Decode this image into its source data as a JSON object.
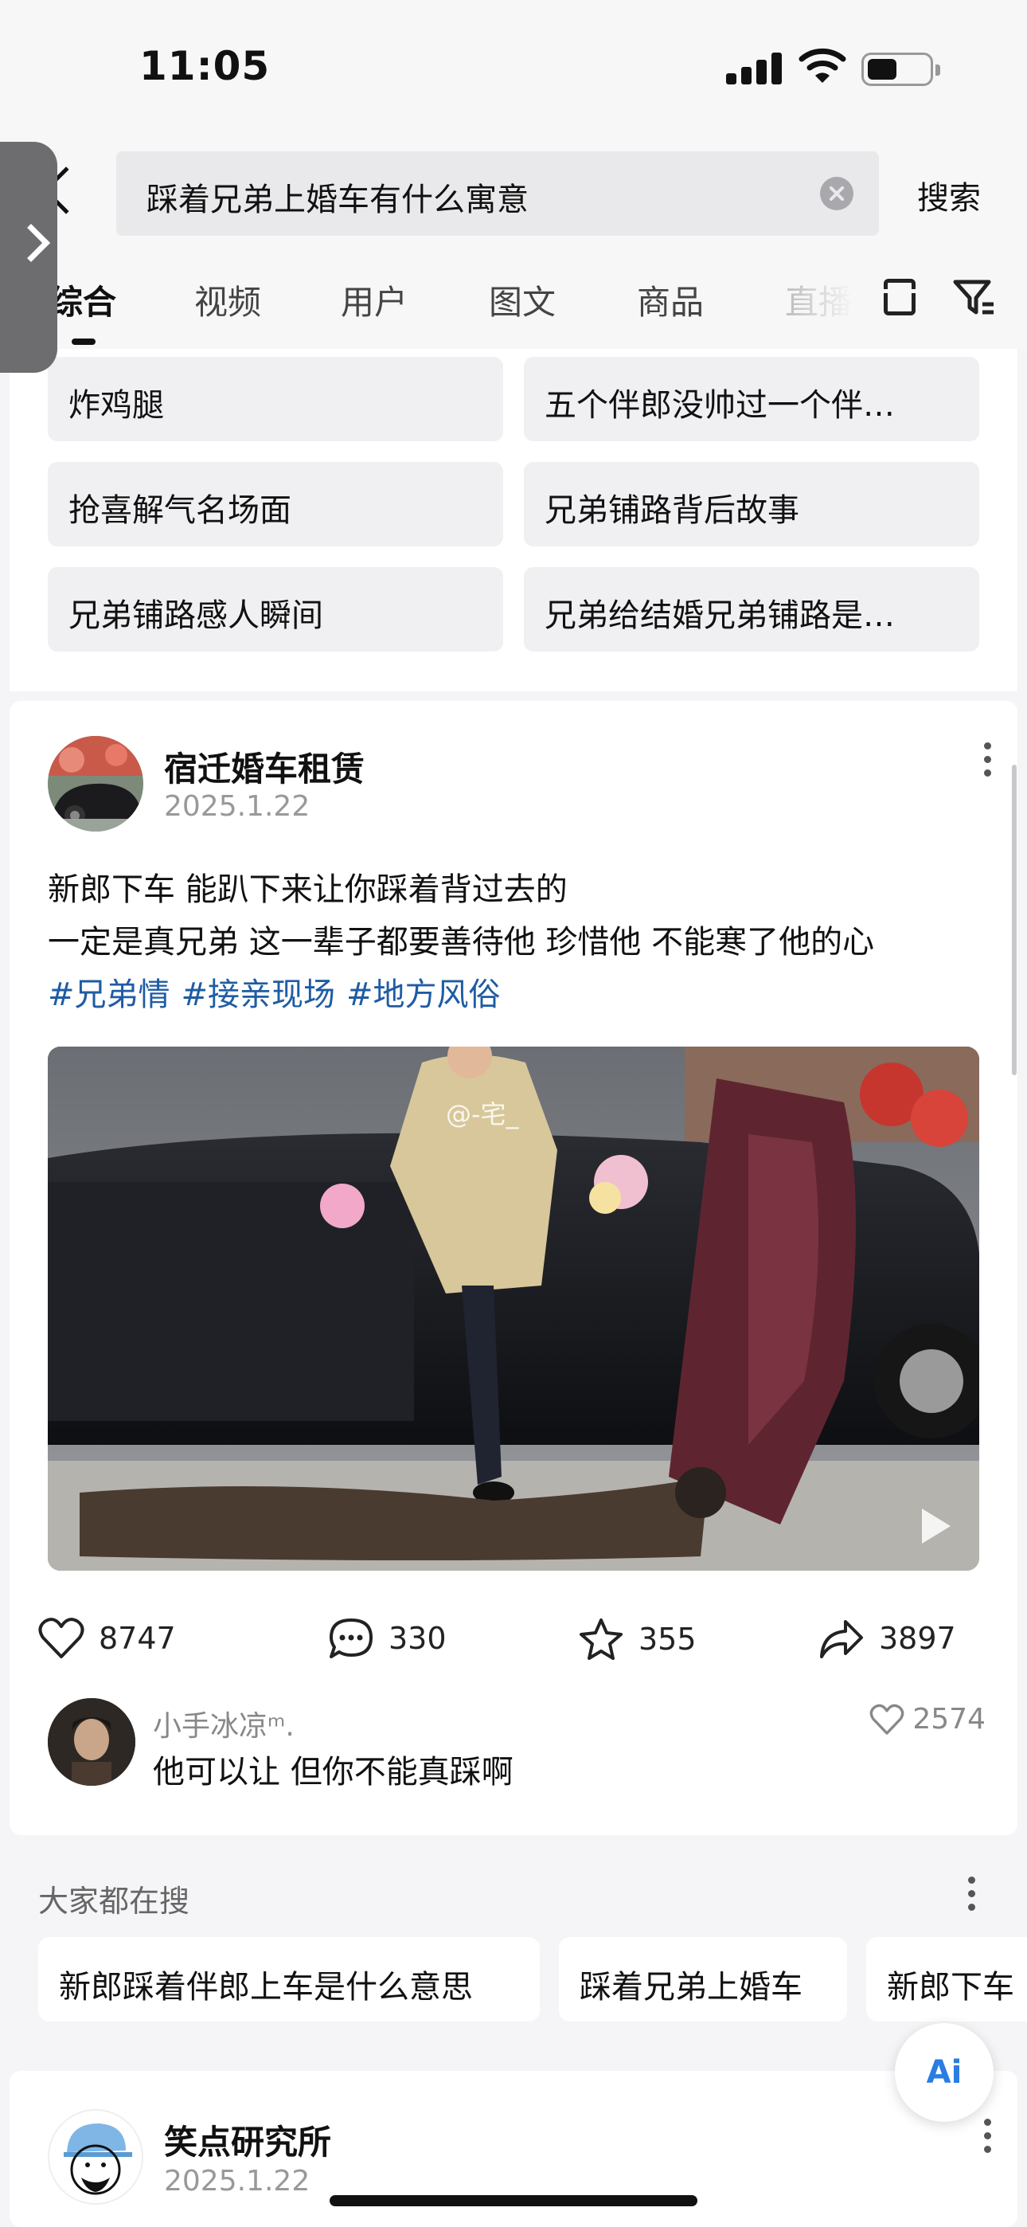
{
  "status_bar": {
    "time": "11:05"
  },
  "search": {
    "query": "踩着兄弟上婚车有什么寓意",
    "submit_label": "搜索"
  },
  "tabs": [
    {
      "label": "综合",
      "active": true
    },
    {
      "label": "视频"
    },
    {
      "label": "用户"
    },
    {
      "label": "图文"
    },
    {
      "label": "商品"
    },
    {
      "label": "直播"
    }
  ],
  "related_chips": [
    "炸鸡腿",
    "五个伴郎没帅过一个伴…",
    "抢喜解气名场面",
    "兄弟铺路背后故事",
    "兄弟铺路感人瞬间",
    "兄弟给结婚兄弟铺路是…"
  ],
  "post": {
    "author": "宿迁婚车租赁",
    "date": "2025.1.22",
    "text_line1": "新郎下车 能趴下来让你踩着背过去的",
    "text_line2": "一定是真兄弟 这一辈子都要善待他 珍惜他 不能寒了他的心",
    "tags": [
      "#兄弟情",
      "#接亲现场",
      "#地方风俗"
    ],
    "image_watermark": "@-宅_",
    "likes": "8747",
    "comments": "330",
    "favorites": "355",
    "shares": "3897",
    "top_comment": {
      "user": "小手冰凉ᵐ.",
      "text": "他可以让 但你不能真踩啊",
      "likes": "2574"
    }
  },
  "also_search": {
    "title": "大家都在搜",
    "items": [
      "新郎踩着伴郎上车是什么意思",
      "踩着兄弟上婚车",
      "新郎下车"
    ]
  },
  "post2": {
    "author": "笑点研究所",
    "date": "2025.1.22"
  },
  "ai_button": {
    "label": "Ai"
  },
  "colors": {
    "hashtag": "#1f5ca3",
    "accent_ai": "#2a7de1",
    "chip_bg": "#f0f0f2"
  }
}
